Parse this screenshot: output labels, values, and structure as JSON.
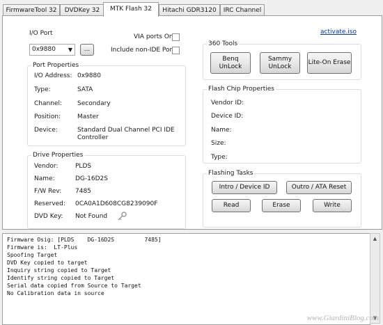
{
  "tabs": [
    {
      "label": "FirmwareTool 32"
    },
    {
      "label": "DVDKey 32"
    },
    {
      "label": "MTK Flash 32"
    },
    {
      "label": "Hitachi GDR3120"
    },
    {
      "label": "IRC Channel"
    }
  ],
  "active_tab": "MTK Flash 32",
  "io_port": {
    "label": "I/O Port",
    "value": "0x9880",
    "browse_label": "...",
    "via_only_label": "VIA ports Only",
    "non_ide_label": "Include non-IDE Ports"
  },
  "activate_link": "activate.iso",
  "port_properties": {
    "title": "Port Properties",
    "rows": [
      {
        "label": "I/O Address:",
        "value": "0x9880"
      },
      {
        "label": "Type:",
        "value": "SATA"
      },
      {
        "label": "Channel:",
        "value": "Secondary"
      },
      {
        "label": "Position:",
        "value": "Master"
      },
      {
        "label": "Device:",
        "value": "Standard Dual Channel PCI IDE\nController"
      }
    ]
  },
  "drive_properties": {
    "title": "Drive Properties",
    "rows": [
      {
        "label": "Vendor:",
        "value": "PLDS"
      },
      {
        "label": "Name:",
        "value": "DG-16D2S"
      },
      {
        "label": "F/W Rev:",
        "value": "7485"
      },
      {
        "label": "Reserved:",
        "value": "0CA0A1D608CG8239090F"
      },
      {
        "label": "DVD Key:",
        "value": "Not Found"
      }
    ]
  },
  "tools_360": {
    "title": "360 Tools",
    "buttons": [
      "Benq\nUnLock",
      "Sammy\nUnLock",
      "Lite-On Erase"
    ]
  },
  "flash_chip": {
    "title": "Flash Chip Properties",
    "rows": [
      "Vendor ID:",
      "Device ID:",
      "Name:",
      "Size:",
      "Type:"
    ]
  },
  "flashing_tasks": {
    "title": "Flashing Tasks",
    "buttons": [
      "Intro / Device ID",
      "Outro / ATA Reset",
      "Read",
      "Erase",
      "Write"
    ]
  },
  "log": {
    "lines": [
      "Firmware Osig: [PLDS    DG-16D2S         7485]",
      "Firmware is:  LT-Plus",
      "Spoofing Target",
      "DVD Key copied to target",
      "Inquiry string copied to Target",
      "Identify string copied to Target",
      "Serial data copied from Source to Target",
      "No Calibration data in source"
    ]
  },
  "watermark": "www.GiardiniBlog.com",
  "colors": {
    "link": "#0033cc",
    "panel_bg": "#ffffff",
    "window_bg": "#f0f0f0"
  }
}
